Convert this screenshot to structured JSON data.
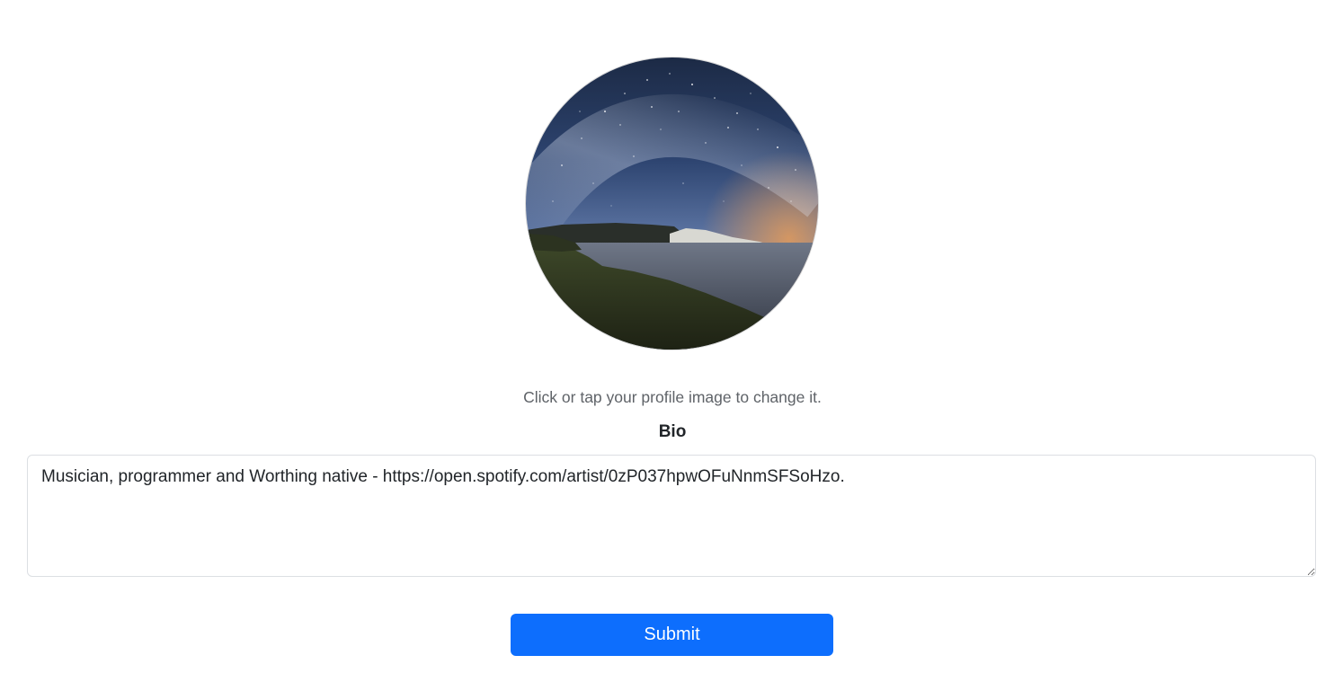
{
  "profile": {
    "image_alt": "Profile image",
    "change_hint": "Click or tap your profile image to change it."
  },
  "bio": {
    "label": "Bio",
    "value": "Musician, programmer and Worthing native - https://open.spotify.com/artist/0zP037hpwOFuNnmSFSoHzo."
  },
  "form": {
    "submit_label": "Submit"
  },
  "colors": {
    "primary": "#0d6efd",
    "hint_text": "#5f6368",
    "label_text": "#212529",
    "input_border": "#dcdfe3"
  }
}
